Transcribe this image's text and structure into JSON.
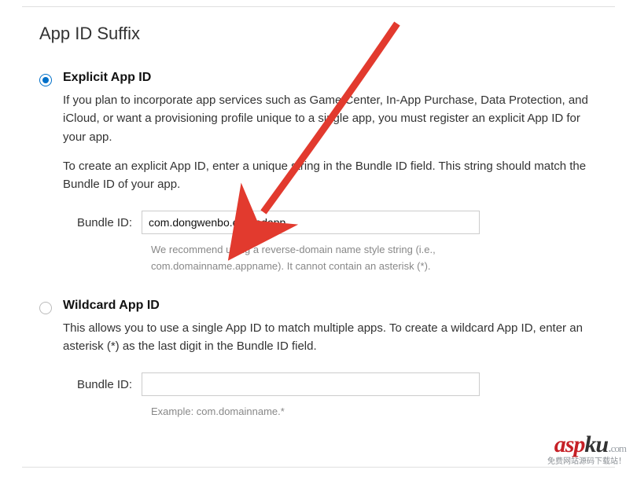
{
  "section_title": "App ID Suffix",
  "options": {
    "explicit": {
      "title": "Explicit App ID",
      "desc1": "If you plan to incorporate app services such as Game Center, In-App Purchase, Data Protection, and iCloud, or want a provisioning profile unique to a single app, you must register an explicit App ID for your app.",
      "desc2": "To create an explicit App ID, enter a unique string in the Bundle ID field. This string should match the Bundle ID of your app.",
      "field_label": "Bundle ID:",
      "field_value": "com.dongwenbo.excitedapp",
      "field_hint": "We recommend using a reverse-domain name style string (i.e., com.domainname.appname). It cannot contain an asterisk (*)."
    },
    "wildcard": {
      "title": "Wildcard App ID",
      "desc1": "This allows you to use a single App ID to match multiple apps. To create a wildcard App ID, enter an asterisk (*) as the last digit in the Bundle ID field.",
      "field_label": "Bundle ID:",
      "field_placeholder": "",
      "field_hint": "Example: com.domainname.*"
    }
  },
  "watermark": {
    "brand_a": "asp",
    "brand_b": "ku",
    "dot": ".",
    "tld": "com",
    "tagline": "免费网站源码下载站！"
  }
}
